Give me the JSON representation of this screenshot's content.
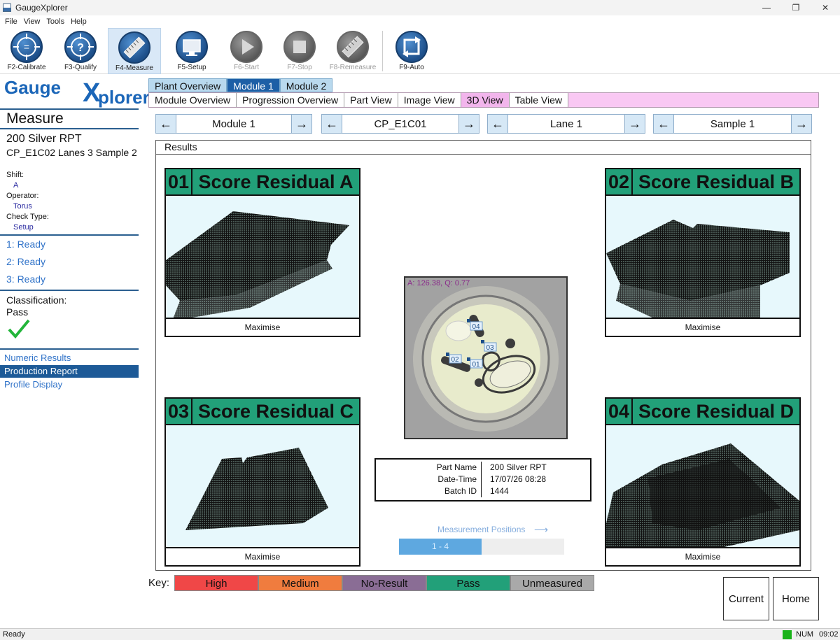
{
  "window": {
    "title": "GaugeXplorer",
    "controls": [
      "—",
      "❐",
      "✕"
    ]
  },
  "menu": [
    "File",
    "View",
    "Tools",
    "Help"
  ],
  "toolbar": {
    "buttons": [
      {
        "label": "F2-Calibrate",
        "icon": "calibrate-crosshair-icon",
        "glyph": "=",
        "enabled": true,
        "active": false
      },
      {
        "label": "F3-Qualify",
        "icon": "qualify-question-icon",
        "glyph": "?",
        "enabled": true,
        "active": false
      },
      {
        "label": "F4-Measure",
        "icon": "measure-ruler-icon",
        "glyph": "",
        "enabled": true,
        "active": true
      },
      {
        "label": "F5-Setup",
        "icon": "setup-monitor-icon",
        "glyph": "",
        "enabled": true,
        "active": false
      },
      {
        "label": "F6-Start",
        "icon": "start-play-icon",
        "glyph": "▶",
        "enabled": false,
        "active": false
      },
      {
        "label": "F7-Stop",
        "icon": "stop-square-icon",
        "glyph": "■",
        "enabled": false,
        "active": false
      },
      {
        "label": "F8-Remeasure",
        "icon": "remeasure-ruler-icon",
        "glyph": "",
        "enabled": false,
        "active": false
      },
      {
        "label": "F9-Auto",
        "icon": "auto-cycle-icon",
        "glyph": "⟳",
        "enabled": true,
        "active": false
      }
    ]
  },
  "logo": {
    "part1": "Gauge",
    "part2": "X",
    "part3": "plorer"
  },
  "left": {
    "mode": "Measure",
    "product": "200 Silver RPT",
    "context": "CP_E1C02 Lanes 3 Sample 2",
    "shift_label": "Shift:",
    "shift": "A",
    "operator_label": "Operator:",
    "operator": "Torus",
    "checktype_label": "Check Type:",
    "checktype": "Setup",
    "statuses": [
      "1: Ready",
      "2: Ready",
      "3: Ready"
    ],
    "classification_label": "Classification:",
    "classification": "Pass",
    "links": [
      {
        "label": "Numeric Results",
        "selected": false
      },
      {
        "label": "Production Report",
        "selected": true
      },
      {
        "label": "Profile Display",
        "selected": false
      }
    ]
  },
  "tabs_top": [
    {
      "label": "Plant Overview",
      "selected": false
    },
    {
      "label": "Module 1",
      "selected": true
    },
    {
      "label": "Module 2",
      "selected": false
    }
  ],
  "tabs_view": [
    {
      "label": "Module Overview",
      "selected": false
    },
    {
      "label": "Progression Overview",
      "selected": false
    },
    {
      "label": "Part View",
      "selected": false
    },
    {
      "label": "Image View",
      "selected": false
    },
    {
      "label": "3D View",
      "selected": true
    },
    {
      "label": "Table View",
      "selected": false
    }
  ],
  "selectors": [
    {
      "value": "Module 1"
    },
    {
      "value": "CP_E1C01"
    },
    {
      "value": "Lane 1"
    },
    {
      "value": "Sample 1"
    }
  ],
  "results": {
    "title": "Results",
    "panels": [
      {
        "num": "01",
        "title": "Score Residual A",
        "button": "Maximise"
      },
      {
        "num": "02",
        "title": "Score Residual B",
        "button": "Maximise"
      },
      {
        "num": "03",
        "title": "Score Residual C",
        "button": "Maximise"
      },
      {
        "num": "04",
        "title": "Score Residual D",
        "button": "Maximise"
      }
    ],
    "camera_readout": "A: 126.38, Q: 0.77",
    "markers": [
      "04",
      "03",
      "02",
      "01"
    ],
    "info": [
      {
        "key": "Part Name",
        "value": "200 Silver RPT"
      },
      {
        "key": "Date-Time",
        "value": "17/07/26 08:28"
      },
      {
        "key": "Batch ID",
        "value": "1444"
      }
    ],
    "positions_label": "Measurement Positions",
    "positions_arrow": "⟶",
    "positions_range": "1 - 4",
    "positions_progress": 0.5
  },
  "key": {
    "label": "Key:",
    "items": [
      {
        "label": "High",
        "color": "#f04747"
      },
      {
        "label": "Medium",
        "color": "#f07c3e"
      },
      {
        "label": "No-Result",
        "color": "#8a6d95"
      },
      {
        "label": "Pass",
        "color": "#22a079"
      },
      {
        "label": "Unmeasured",
        "color": "#a9a9a9"
      }
    ]
  },
  "buttons": {
    "current": "Current",
    "home": "Home"
  },
  "status": {
    "text": "Ready",
    "num": "NUM",
    "clock": "09:02"
  },
  "colors": {
    "accent": "#1d5fa6",
    "pass": "#22a079",
    "brand": "#1b66b8"
  }
}
